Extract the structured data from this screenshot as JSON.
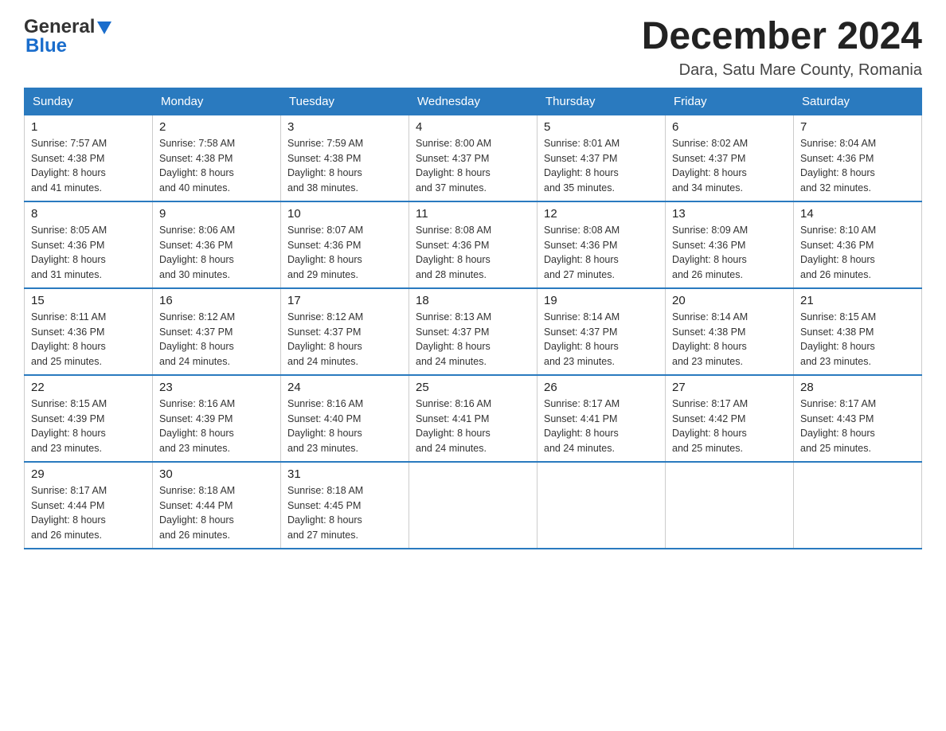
{
  "header": {
    "logo_general": "General",
    "logo_blue": "Blue",
    "month_title": "December 2024",
    "location": "Dara, Satu Mare County, Romania"
  },
  "days_of_week": [
    "Sunday",
    "Monday",
    "Tuesday",
    "Wednesday",
    "Thursday",
    "Friday",
    "Saturday"
  ],
  "weeks": [
    [
      {
        "day": "1",
        "sunrise": "7:57 AM",
        "sunset": "4:38 PM",
        "daylight": "8 hours and 41 minutes."
      },
      {
        "day": "2",
        "sunrise": "7:58 AM",
        "sunset": "4:38 PM",
        "daylight": "8 hours and 40 minutes."
      },
      {
        "day": "3",
        "sunrise": "7:59 AM",
        "sunset": "4:38 PM",
        "daylight": "8 hours and 38 minutes."
      },
      {
        "day": "4",
        "sunrise": "8:00 AM",
        "sunset": "4:37 PM",
        "daylight": "8 hours and 37 minutes."
      },
      {
        "day": "5",
        "sunrise": "8:01 AM",
        "sunset": "4:37 PM",
        "daylight": "8 hours and 35 minutes."
      },
      {
        "day": "6",
        "sunrise": "8:02 AM",
        "sunset": "4:37 PM",
        "daylight": "8 hours and 34 minutes."
      },
      {
        "day": "7",
        "sunrise": "8:04 AM",
        "sunset": "4:36 PM",
        "daylight": "8 hours and 32 minutes."
      }
    ],
    [
      {
        "day": "8",
        "sunrise": "8:05 AM",
        "sunset": "4:36 PM",
        "daylight": "8 hours and 31 minutes."
      },
      {
        "day": "9",
        "sunrise": "8:06 AM",
        "sunset": "4:36 PM",
        "daylight": "8 hours and 30 minutes."
      },
      {
        "day": "10",
        "sunrise": "8:07 AM",
        "sunset": "4:36 PM",
        "daylight": "8 hours and 29 minutes."
      },
      {
        "day": "11",
        "sunrise": "8:08 AM",
        "sunset": "4:36 PM",
        "daylight": "8 hours and 28 minutes."
      },
      {
        "day": "12",
        "sunrise": "8:08 AM",
        "sunset": "4:36 PM",
        "daylight": "8 hours and 27 minutes."
      },
      {
        "day": "13",
        "sunrise": "8:09 AM",
        "sunset": "4:36 PM",
        "daylight": "8 hours and 26 minutes."
      },
      {
        "day": "14",
        "sunrise": "8:10 AM",
        "sunset": "4:36 PM",
        "daylight": "8 hours and 26 minutes."
      }
    ],
    [
      {
        "day": "15",
        "sunrise": "8:11 AM",
        "sunset": "4:36 PM",
        "daylight": "8 hours and 25 minutes."
      },
      {
        "day": "16",
        "sunrise": "8:12 AM",
        "sunset": "4:37 PM",
        "daylight": "8 hours and 24 minutes."
      },
      {
        "day": "17",
        "sunrise": "8:12 AM",
        "sunset": "4:37 PM",
        "daylight": "8 hours and 24 minutes."
      },
      {
        "day": "18",
        "sunrise": "8:13 AM",
        "sunset": "4:37 PM",
        "daylight": "8 hours and 24 minutes."
      },
      {
        "day": "19",
        "sunrise": "8:14 AM",
        "sunset": "4:37 PM",
        "daylight": "8 hours and 23 minutes."
      },
      {
        "day": "20",
        "sunrise": "8:14 AM",
        "sunset": "4:38 PM",
        "daylight": "8 hours and 23 minutes."
      },
      {
        "day": "21",
        "sunrise": "8:15 AM",
        "sunset": "4:38 PM",
        "daylight": "8 hours and 23 minutes."
      }
    ],
    [
      {
        "day": "22",
        "sunrise": "8:15 AM",
        "sunset": "4:39 PM",
        "daylight": "8 hours and 23 minutes."
      },
      {
        "day": "23",
        "sunrise": "8:16 AM",
        "sunset": "4:39 PM",
        "daylight": "8 hours and 23 minutes."
      },
      {
        "day": "24",
        "sunrise": "8:16 AM",
        "sunset": "4:40 PM",
        "daylight": "8 hours and 23 minutes."
      },
      {
        "day": "25",
        "sunrise": "8:16 AM",
        "sunset": "4:41 PM",
        "daylight": "8 hours and 24 minutes."
      },
      {
        "day": "26",
        "sunrise": "8:17 AM",
        "sunset": "4:41 PM",
        "daylight": "8 hours and 24 minutes."
      },
      {
        "day": "27",
        "sunrise": "8:17 AM",
        "sunset": "4:42 PM",
        "daylight": "8 hours and 25 minutes."
      },
      {
        "day": "28",
        "sunrise": "8:17 AM",
        "sunset": "4:43 PM",
        "daylight": "8 hours and 25 minutes."
      }
    ],
    [
      {
        "day": "29",
        "sunrise": "8:17 AM",
        "sunset": "4:44 PM",
        "daylight": "8 hours and 26 minutes."
      },
      {
        "day": "30",
        "sunrise": "8:18 AM",
        "sunset": "4:44 PM",
        "daylight": "8 hours and 26 minutes."
      },
      {
        "day": "31",
        "sunrise": "8:18 AM",
        "sunset": "4:45 PM",
        "daylight": "8 hours and 27 minutes."
      },
      null,
      null,
      null,
      null
    ]
  ],
  "labels": {
    "sunrise": "Sunrise:",
    "sunset": "Sunset:",
    "daylight": "Daylight:"
  }
}
